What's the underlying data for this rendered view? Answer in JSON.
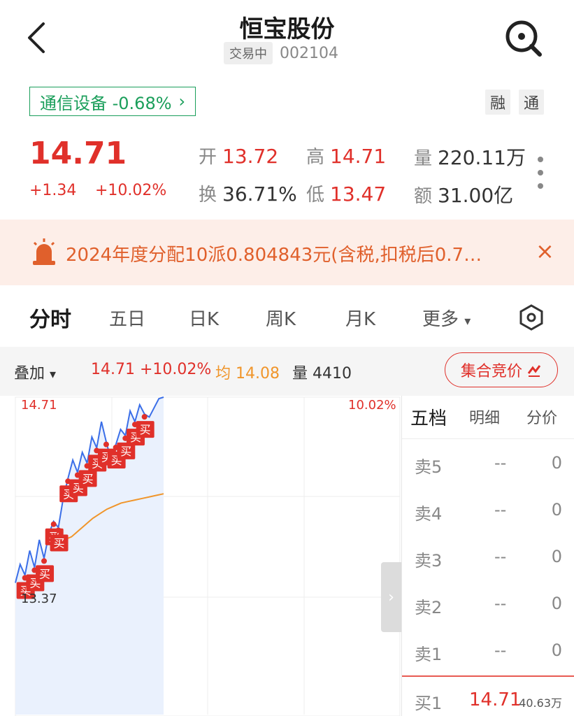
{
  "header": {
    "title": "恒宝股份",
    "status": "交易中",
    "code": "002104"
  },
  "sector": {
    "label": "通信设备 -0.68%",
    "chevron": "›"
  },
  "tags": [
    "融",
    "通"
  ],
  "quote": {
    "price": "14.71",
    "change": "+1.34",
    "change_pct": "+10.02%",
    "fields": [
      {
        "label": "开",
        "value": "13.72"
      },
      {
        "label": "高",
        "value": "14.71"
      },
      {
        "label": "量",
        "value": "220.11万"
      },
      {
        "label": "换",
        "value": "36.71%"
      },
      {
        "label": "低",
        "value": "13.47"
      },
      {
        "label": "额",
        "value": "31.00亿"
      }
    ]
  },
  "notice": {
    "text": "2024年度分配10派0.804843元(含税,扣税后0.7…",
    "close": "×"
  },
  "tabs": [
    "分时",
    "五日",
    "日K",
    "周K",
    "月K",
    "更多"
  ],
  "tab_more_arrow": "▾",
  "overlay": {
    "label": "叠加",
    "arrow": "▾",
    "price": "14.71",
    "pct": "+10.02%",
    "avg_label": "均",
    "avg_value": "14.08",
    "vol_label": "量",
    "vol_value": "4410",
    "auction_label": "集合竞价"
  },
  "chart": {
    "y_top": "14.71",
    "y_bottom": "13.37",
    "pct_top": "10.02%",
    "marker_label": "买"
  },
  "chart_data": {
    "type": "line",
    "title": "",
    "xlabel": "",
    "ylabel": "",
    "ylim": [
      13.37,
      14.71
    ],
    "series": [
      {
        "values": [
          13.5,
          13.62,
          13.55,
          13.71,
          13.6,
          13.78,
          13.66,
          13.82,
          13.9,
          13.86,
          14.05,
          14.18,
          14.3,
          14.22,
          14.35,
          14.28,
          14.45,
          14.38,
          14.55,
          14.42,
          14.3,
          14.4,
          14.5,
          14.46,
          14.62,
          14.55,
          14.66,
          14.6,
          14.58,
          14.64,
          14.7,
          14.71
        ]
      },
      {
        "values": [
          13.72,
          13.78,
          13.8,
          13.84,
          13.88,
          13.92,
          13.95,
          13.98,
          14.0,
          14.02,
          14.03,
          14.04,
          14.05,
          14.06,
          14.07,
          14.08
        ]
      }
    ]
  },
  "order_book": {
    "tabs": [
      "五档",
      "明细",
      "分价"
    ],
    "rows": [
      {
        "label": "卖5",
        "price": "--",
        "volume": "0"
      },
      {
        "label": "卖4",
        "price": "--",
        "volume": "0"
      },
      {
        "label": "卖3",
        "price": "--",
        "volume": "0"
      },
      {
        "label": "卖2",
        "price": "--",
        "volume": "0"
      },
      {
        "label": "卖1",
        "price": "--",
        "volume": "0"
      }
    ],
    "buy1": {
      "label": "买1",
      "price": "14.71",
      "volume": "40.63万"
    }
  },
  "colors": {
    "up": "#e0302a",
    "sector_green": "#1a9e5a",
    "notice_orange": "#e0602c",
    "price_line": "#3a6ee8",
    "avg_line": "#f0952a"
  }
}
